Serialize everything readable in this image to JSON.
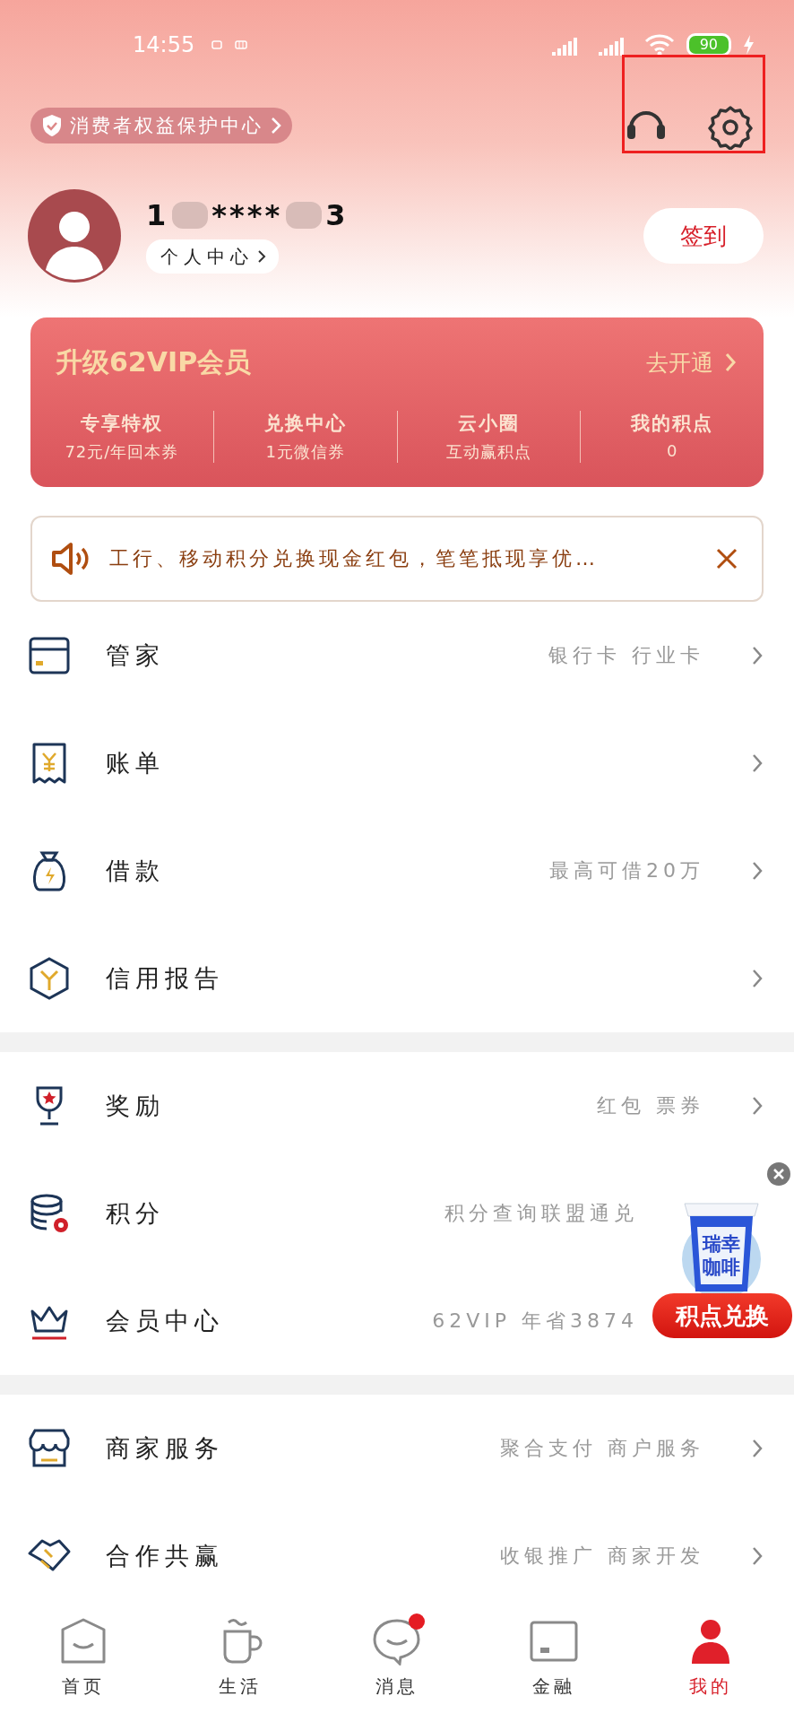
{
  "status_bar": {
    "time": "14:55",
    "battery": "90"
  },
  "header": {
    "rights_link": "消费者权益保护中心",
    "highlight_frame": true
  },
  "profile": {
    "name_parts": [
      "1",
      "****",
      "3"
    ],
    "center_link": "个人中心",
    "sign_in": "签到"
  },
  "vip_card": {
    "title": "升级62VIP会员",
    "action": "去开通",
    "stats": [
      {
        "label": "专享特权",
        "sub": "72元/年回本券"
      },
      {
        "label": "兑换中心",
        "sub": "1元微信券"
      },
      {
        "label": "云小圈",
        "sub": "互动赢积点"
      },
      {
        "label": "我的积点",
        "sub": "0"
      }
    ]
  },
  "notice": {
    "text": "工行、移动积分兑换现金红包，笔笔抵现享优…"
  },
  "groups": [
    [
      {
        "label": "管家",
        "sub": "银行卡 行业卡",
        "chevron": true
      },
      {
        "label": "账单",
        "chevron": true
      },
      {
        "label": "借款",
        "sub": "最高可借20万",
        "chevron": true
      },
      {
        "label": "信用报告",
        "chevron": true
      }
    ],
    [
      {
        "label": "奖励",
        "sub": "红包 票券",
        "chevron": true
      },
      {
        "label": "积分",
        "sub": "积分查询联盟通兑",
        "chevron": false
      },
      {
        "label": "会员中心",
        "sub": "62VIP 年省3874",
        "chevron": false
      }
    ],
    [
      {
        "label": "商家服务",
        "sub": "聚合支付 商户服务",
        "chevron": true
      },
      {
        "label": "合作共赢",
        "sub": "收银推广 商家开发",
        "chevron": true
      }
    ]
  ],
  "floating_ad": {
    "cup_lines": [
      "瑞幸",
      "咖啡"
    ],
    "button": "积点兑换"
  },
  "tabs": [
    {
      "label": "首页",
      "selected": false,
      "badge": false
    },
    {
      "label": "生活",
      "selected": false,
      "badge": false
    },
    {
      "label": "消息",
      "selected": false,
      "badge": true
    },
    {
      "label": "金融",
      "selected": false,
      "badge": false
    },
    {
      "label": "我的",
      "selected": true,
      "badge": false
    }
  ]
}
